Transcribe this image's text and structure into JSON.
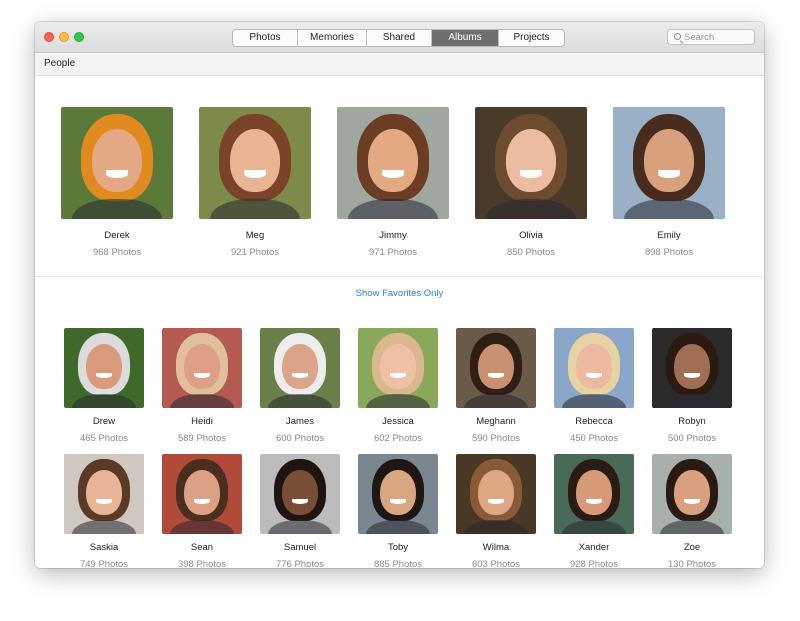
{
  "window": {
    "tabs": [
      {
        "label": "Photos",
        "active": false
      },
      {
        "label": "Memories",
        "active": false
      },
      {
        "label": "Shared",
        "active": false
      },
      {
        "label": "Albums",
        "active": true
      },
      {
        "label": "Projects",
        "active": false
      }
    ],
    "search_placeholder": "Search"
  },
  "header": {
    "title": "People"
  },
  "favorites": [
    {
      "name": "Derek",
      "count": "968 Photos",
      "bg": "#5b7a3a",
      "skin": "#e3a884",
      "hair": "#e08a20"
    },
    {
      "name": "Meg",
      "count": "921 Photos",
      "bg": "#7d8a4a",
      "skin": "#e9b494",
      "hair": "#7a4428"
    },
    {
      "name": "Jimmy",
      "count": "971 Photos",
      "bg": "#a0a6a0",
      "skin": "#e3aa82",
      "hair": "#6b3d22"
    },
    {
      "name": "Olivia",
      "count": "850 Photos",
      "bg": "#4a3a2a",
      "skin": "#ecbca0",
      "hair": "#6e4a2e"
    },
    {
      "name": "Emily",
      "count": "898 Photos",
      "bg": "#9ab0c6",
      "skin": "#d9a07e",
      "hair": "#4a2c1e"
    }
  ],
  "show_favorites_label": "Show Favorites Only",
  "people": [
    {
      "name": "Drew",
      "count": "465 Photos",
      "bg": "#3f6a2a",
      "skin": "#d89a7a",
      "hair": "#dcdcdc"
    },
    {
      "name": "Heidi",
      "count": "589 Photos",
      "bg": "#b45a50",
      "skin": "#dea084",
      "hair": "#e0c09a"
    },
    {
      "name": "James",
      "count": "600 Photos",
      "bg": "#6a8048",
      "skin": "#dca488",
      "hair": "#ededed"
    },
    {
      "name": "Jessica",
      "count": "602 Photos",
      "bg": "#8aa85a",
      "skin": "#efc0a4",
      "hair": "#d8b88c"
    },
    {
      "name": "Meghann",
      "count": "590 Photos",
      "bg": "#6a5a4a",
      "skin": "#c89272",
      "hair": "#2e1e16"
    },
    {
      "name": "Rebecca",
      "count": "450 Photos",
      "bg": "#8aa6c8",
      "skin": "#ebbaa0",
      "hair": "#e6d2a2"
    },
    {
      "name": "Robyn",
      "count": "500 Photos",
      "bg": "#2a2a2a",
      "skin": "#a06e52",
      "hair": "#2a1a12"
    },
    {
      "name": "Saskia",
      "count": "749 Photos",
      "bg": "#cfc8c0",
      "skin": "#e7b496",
      "hair": "#5a3a26"
    },
    {
      "name": "Sean",
      "count": "398 Photos",
      "bg": "#b24a3a",
      "skin": "#dca084",
      "hair": "#4a2e1e"
    },
    {
      "name": "Samuel",
      "count": "776 Photos",
      "bg": "#bcbcbc",
      "skin": "#7a4e36",
      "hair": "#1e1410"
    },
    {
      "name": "Toby",
      "count": "885 Photos",
      "bg": "#7a8690",
      "skin": "#d8a680",
      "hair": "#1e1612"
    },
    {
      "name": "Wilma",
      "count": "603 Photos",
      "bg": "#4a3826",
      "skin": "#dca884",
      "hair": "#8a5a36"
    },
    {
      "name": "Xander",
      "count": "928 Photos",
      "bg": "#4a6a58",
      "skin": "#d69a78",
      "hair": "#2a1c14"
    },
    {
      "name": "Zoe",
      "count": "130 Photos",
      "bg": "#a8b0ac",
      "skin": "#d8a07e",
      "hair": "#2a1a14"
    }
  ]
}
